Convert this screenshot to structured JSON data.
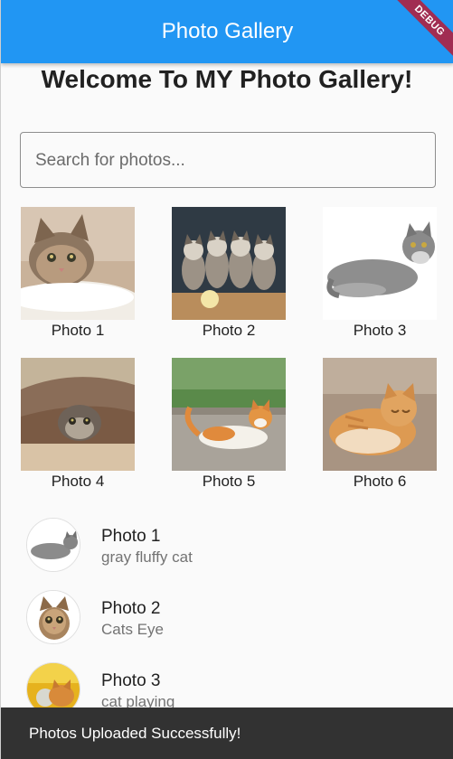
{
  "app_bar": {
    "title": "Photo Gallery",
    "debug_banner": "DEBUG",
    "color": "#2196f3"
  },
  "welcome": "Welcome To MY Photo Gallery!",
  "search": {
    "placeholder": "Search for photos...",
    "value": ""
  },
  "grid": [
    {
      "label": "Photo 1",
      "image": "tabby-cat-on-fluffy-blanket"
    },
    {
      "label": "Photo 2",
      "image": "four-kittens-with-ball"
    },
    {
      "label": "Photo 3",
      "image": "gray-cat-lying-down"
    },
    {
      "label": "Photo 4",
      "image": "kitten-under-blanket"
    },
    {
      "label": "Photo 5",
      "image": "orange-white-cat-on-ground"
    },
    {
      "label": "Photo 6",
      "image": "orange-cat-on-floor"
    }
  ],
  "list": [
    {
      "title": "Photo 1",
      "subtitle": "gray fluffy cat",
      "image": "gray-cat-lying-down"
    },
    {
      "title": "Photo 2",
      "subtitle": "Cats Eye",
      "image": "tabby-kitten-face"
    },
    {
      "title": "Photo 3",
      "subtitle": "cat playing",
      "image": "cat-playing-yellow"
    }
  ],
  "snackbar": {
    "message": "Photos Uploaded Successfully!"
  }
}
